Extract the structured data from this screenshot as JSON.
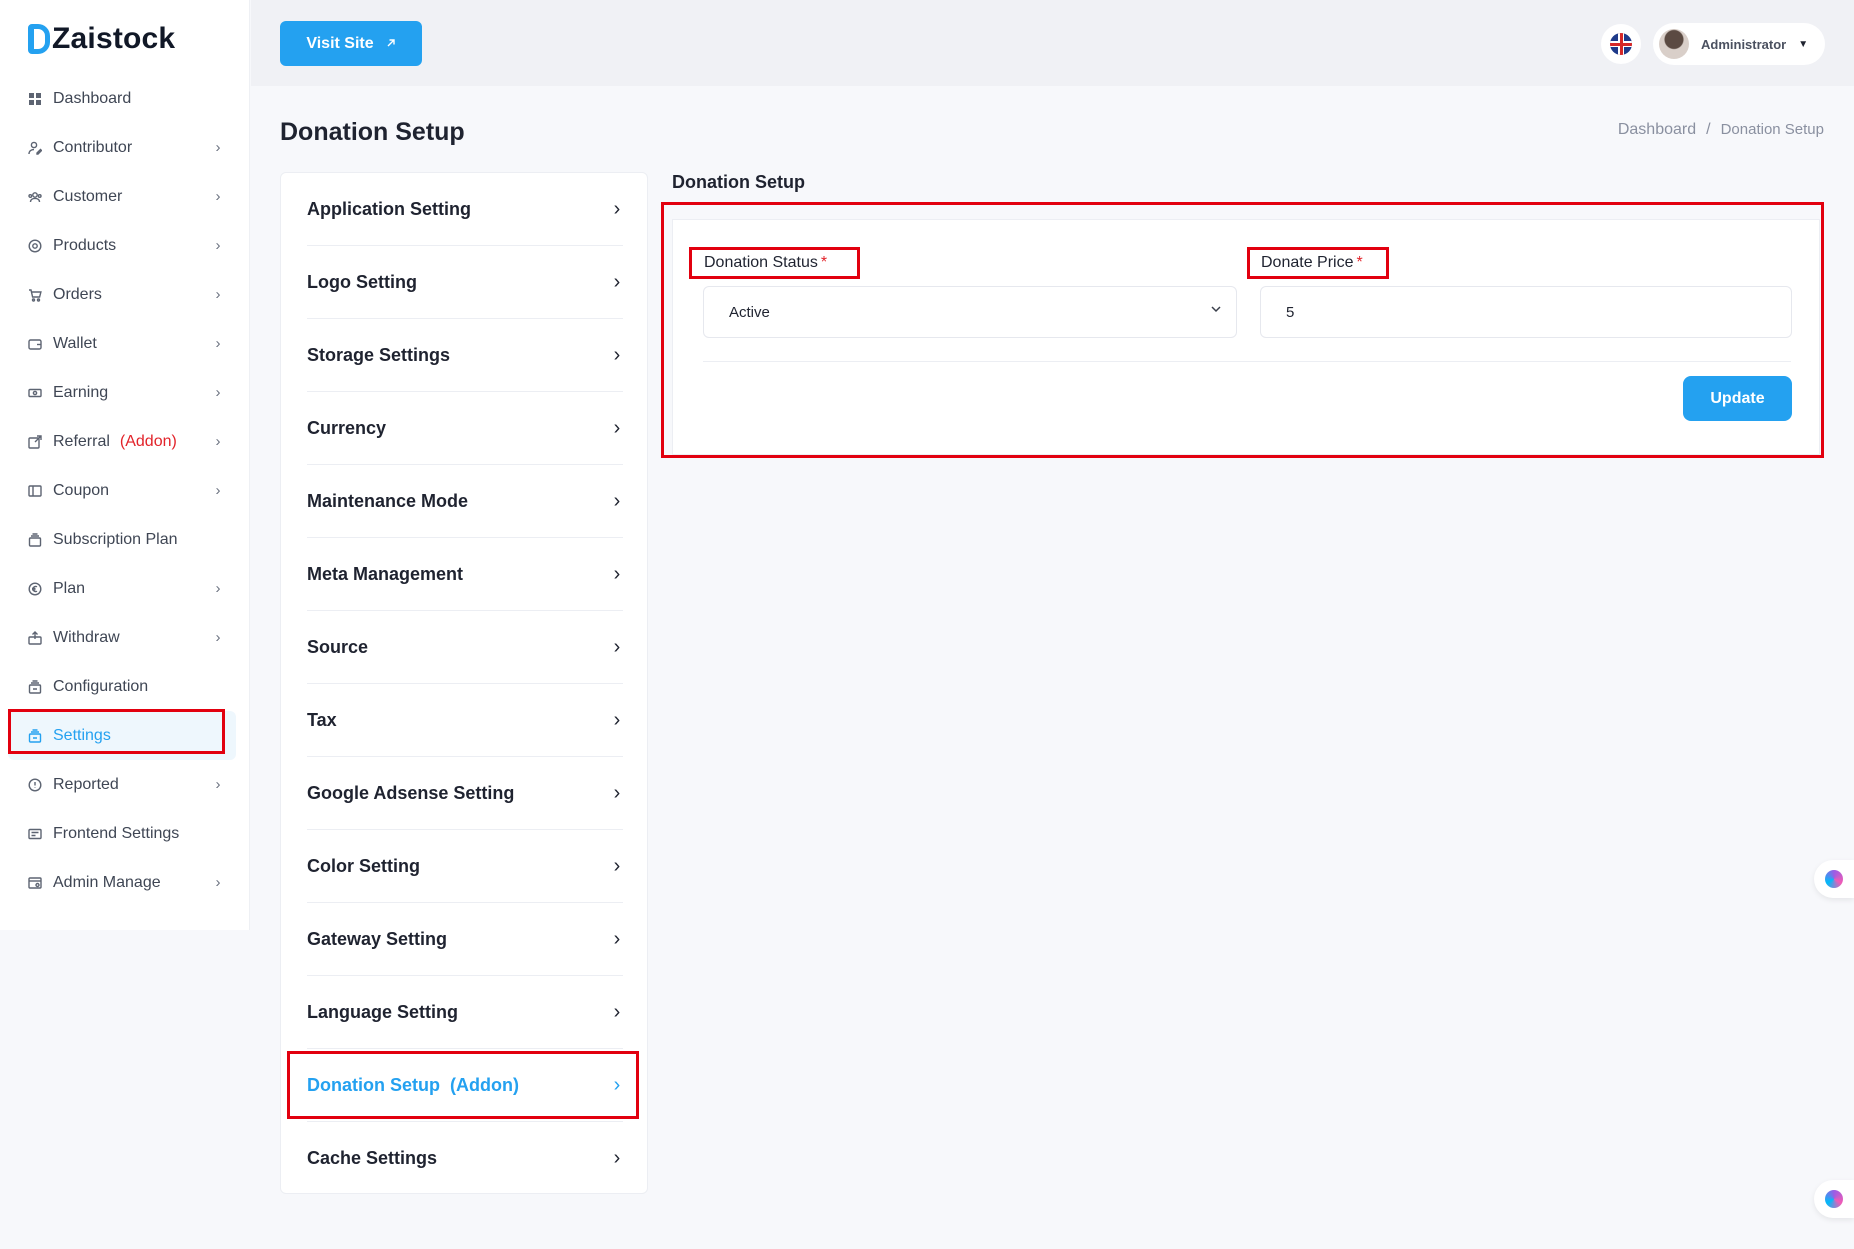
{
  "app": {
    "logo_text": "Zaistock",
    "accent": "#24a1f0",
    "alert_color": "#e2232a"
  },
  "sidebar": {
    "items": [
      {
        "label": "Dashboard",
        "icon": "grid-icon",
        "has_submenu": false
      },
      {
        "label": "Contributor",
        "icon": "user-edit-icon",
        "has_submenu": true
      },
      {
        "label": "Customer",
        "icon": "users-icon",
        "has_submenu": true
      },
      {
        "label": "Products",
        "icon": "box-icon",
        "has_submenu": true
      },
      {
        "label": "Orders",
        "icon": "cart-icon",
        "has_submenu": true
      },
      {
        "label": "Wallet",
        "icon": "wallet-icon",
        "has_submenu": true
      },
      {
        "label": "Earning",
        "icon": "money-icon",
        "has_submenu": true
      },
      {
        "label": "Referral",
        "addon": "(Addon)",
        "icon": "share-icon",
        "has_submenu": true
      },
      {
        "label": "Coupon",
        "icon": "ticket-icon",
        "has_submenu": true
      },
      {
        "label": "Subscription Plan",
        "icon": "layers-icon",
        "has_submenu": false
      },
      {
        "label": "Plan",
        "icon": "euro-icon",
        "has_submenu": true
      },
      {
        "label": "Withdraw",
        "icon": "withdraw-icon",
        "has_submenu": true
      },
      {
        "label": "Configuration",
        "icon": "config-icon",
        "has_submenu": false
      },
      {
        "label": "Settings",
        "icon": "settings-icon",
        "has_submenu": false,
        "active": true
      },
      {
        "label": "Reported",
        "icon": "alert-icon",
        "has_submenu": true
      },
      {
        "label": "Frontend Settings",
        "icon": "frontend-icon",
        "has_submenu": false
      },
      {
        "label": "Admin Manage",
        "icon": "admin-icon",
        "has_submenu": true
      }
    ]
  },
  "topbar": {
    "visit_site_label": "Visit Site",
    "language_icon": "uk-flag-icon",
    "user_name": "Administrator"
  },
  "page": {
    "title": "Donation Setup",
    "breadcrumb": {
      "root": "Dashboard",
      "separator": "/",
      "current": "Donation Setup"
    }
  },
  "settings_menu": {
    "items": [
      {
        "label": "Application Setting"
      },
      {
        "label": "Logo Setting"
      },
      {
        "label": "Storage Settings"
      },
      {
        "label": "Currency"
      },
      {
        "label": "Maintenance Mode"
      },
      {
        "label": "Meta Management"
      },
      {
        "label": "Source"
      },
      {
        "label": "Tax"
      },
      {
        "label": "Google Adsense Setting"
      },
      {
        "label": "Color Setting"
      },
      {
        "label": "Gateway Setting"
      },
      {
        "label": "Language Setting"
      },
      {
        "label": "Donation Setup",
        "addon": "(Addon)",
        "active": true
      },
      {
        "label": "Cache Settings"
      }
    ]
  },
  "donation_form": {
    "section_title": "Donation Setup",
    "status_label": "Donation Status",
    "status_value": "Active",
    "price_label": "Donate Price",
    "price_value": "5",
    "required_mark": "*",
    "update_label": "Update"
  }
}
